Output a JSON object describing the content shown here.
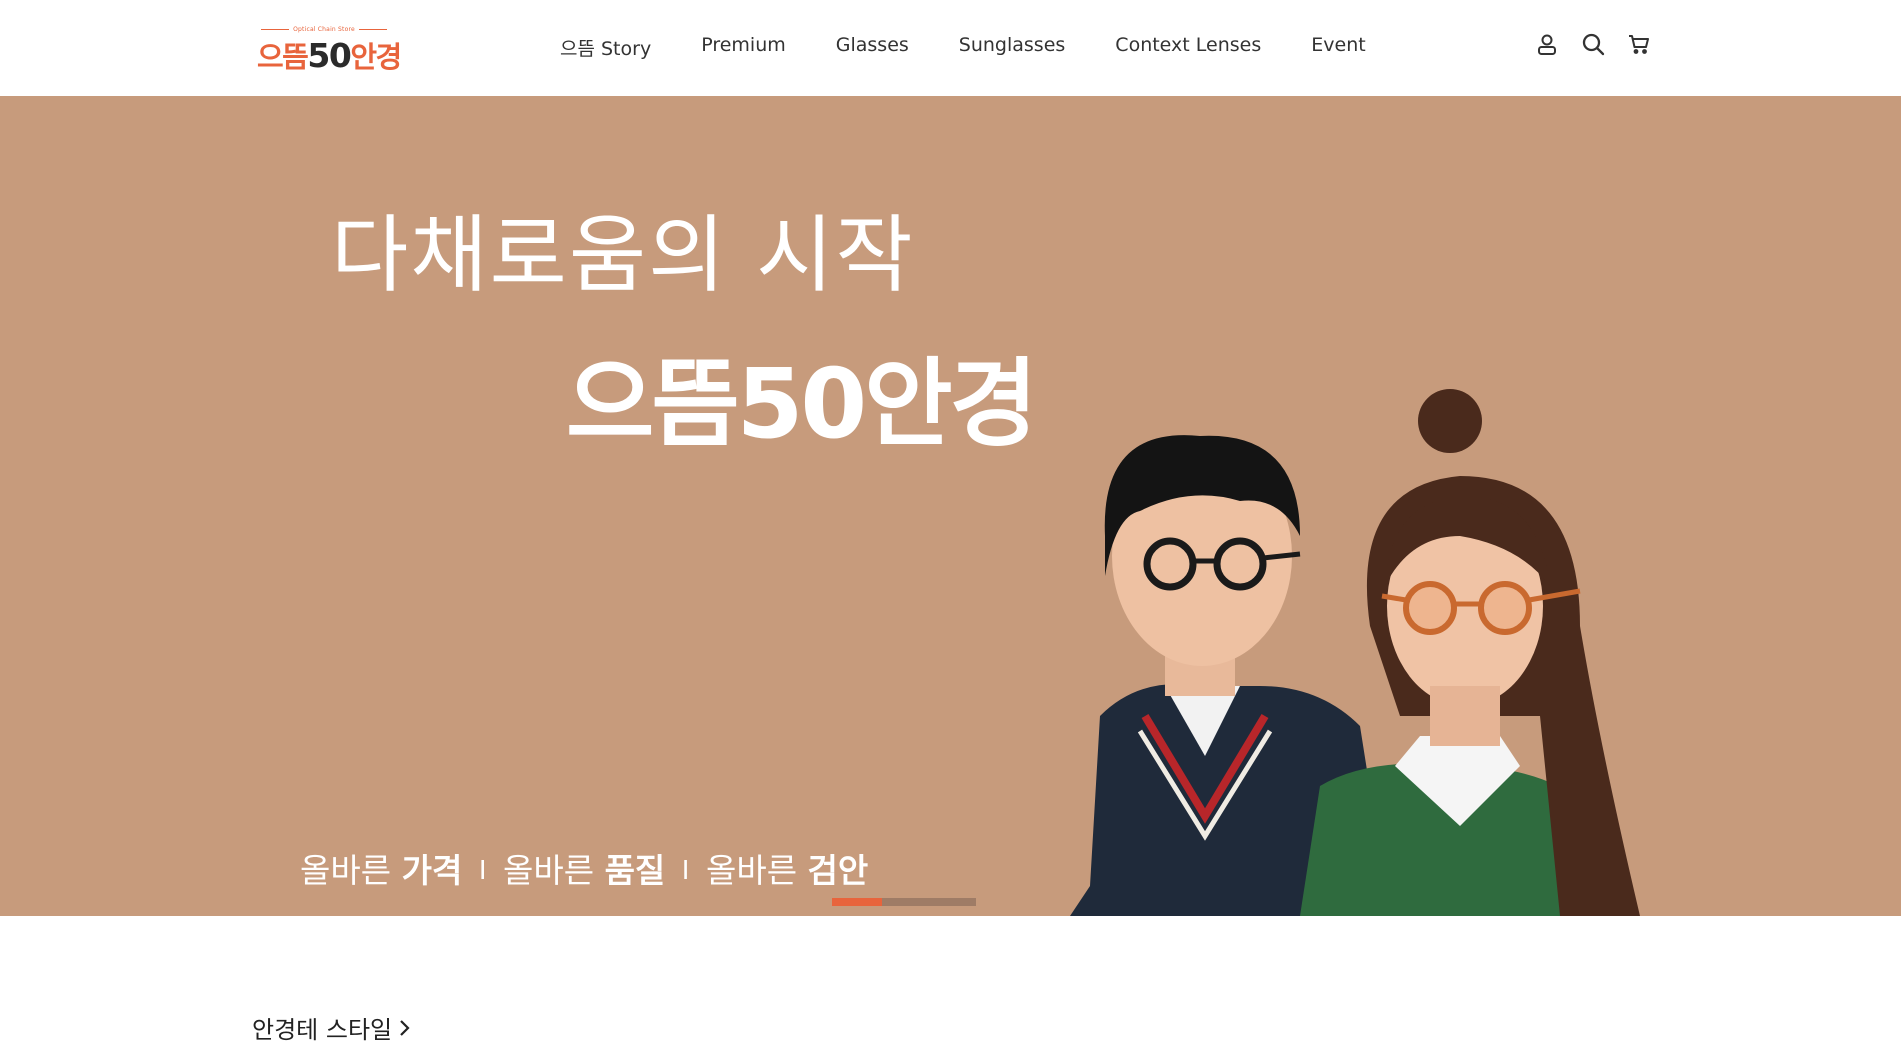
{
  "header": {
    "logo": {
      "tagline": "Optical Chain Store",
      "part1": "으뜸",
      "part2": "50",
      "part3": "안경"
    },
    "nav": [
      {
        "label": "으뜸 Story"
      },
      {
        "label": "Premium"
      },
      {
        "label": "Glasses"
      },
      {
        "label": "Sunglasses"
      },
      {
        "label": "Context Lenses"
      },
      {
        "label": "Event"
      }
    ],
    "icons": [
      "user-icon",
      "search-icon",
      "cart-icon"
    ]
  },
  "hero": {
    "title": "다채로움의 시작",
    "brand": "으뜸50안경",
    "slogan": {
      "p1": "올바른 ",
      "b1": "가격",
      "sep": "I",
      "p2": "올바른 ",
      "b2": "품질",
      "p3": "올바른 ",
      "b3": "검안"
    },
    "background_color": "#c79b7c",
    "accent_color": "#e8643c",
    "slide_progress": 0.35
  },
  "section": {
    "title": "안경테 스타일"
  }
}
